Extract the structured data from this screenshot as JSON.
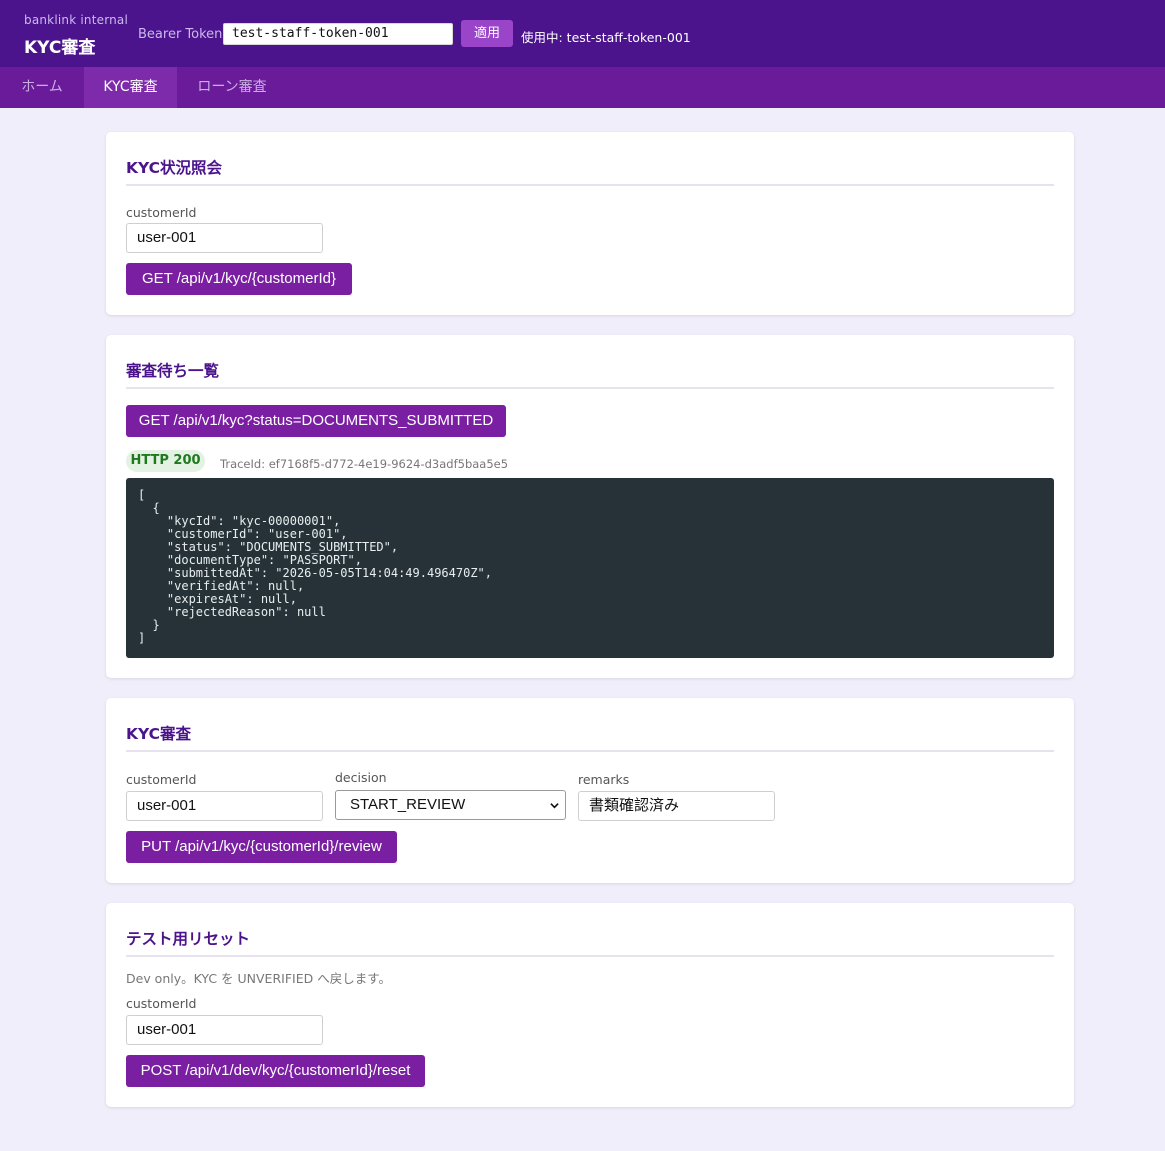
{
  "header": {
    "brand_sub": "banklink internal",
    "brand_title": "KYC審査",
    "token_label": "Bearer Token",
    "token_value": "test-staff-token-001",
    "apply_label": "適用",
    "using_text": "使用中: test-staff-token-001"
  },
  "nav": {
    "tabs": [
      {
        "label": "ホーム",
        "active": false
      },
      {
        "label": "KYC審査",
        "active": true
      },
      {
        "label": "ローン審査",
        "active": false
      }
    ]
  },
  "status_card": {
    "title": "KYC状況照会",
    "customer_label": "customerId",
    "customer_value": "user-001",
    "button_label": "GET /api/v1/kyc/{customerId}"
  },
  "pending_card": {
    "title": "審査待ち一覧",
    "button_label": "GET /api/v1/kyc?status=DOCUMENTS_SUBMITTED",
    "status_badge": "HTTP 200",
    "trace_text": "TraceId: ef7168f5-d772-4e19-9624-d3adf5baa5e5",
    "response_body": "[\n  {\n    \"kycId\": \"kyc-00000001\",\n    \"customerId\": \"user-001\",\n    \"status\": \"DOCUMENTS_SUBMITTED\",\n    \"documentType\": \"PASSPORT\",\n    \"submittedAt\": \"2026-05-05T14:04:49.496470Z\",\n    \"verifiedAt\": null,\n    \"expiresAt\": null,\n    \"rejectedReason\": null\n  }\n]"
  },
  "review_card": {
    "title": "KYC審査",
    "customer_label": "customerId",
    "customer_value": "user-001",
    "decision_label": "decision",
    "decision_value": "START_REVIEW",
    "remarks_label": "remarks",
    "remarks_value": "書類確認済み",
    "button_label": "PUT /api/v1/kyc/{customerId}/review"
  },
  "reset_card": {
    "title": "テスト用リセット",
    "note": "Dev only。KYC を UNVERIFIED へ戻します。",
    "customer_label": "customerId",
    "customer_value": "user-001",
    "button_label": "POST /api/v1/dev/kyc/{customerId}/reset"
  },
  "colors": {
    "header_bg": "#4b148c",
    "nav_bg": "#6a1b9a",
    "button_bg": "#7b1fa2",
    "page_bg": "#f1eefb",
    "code_bg": "#263238"
  }
}
